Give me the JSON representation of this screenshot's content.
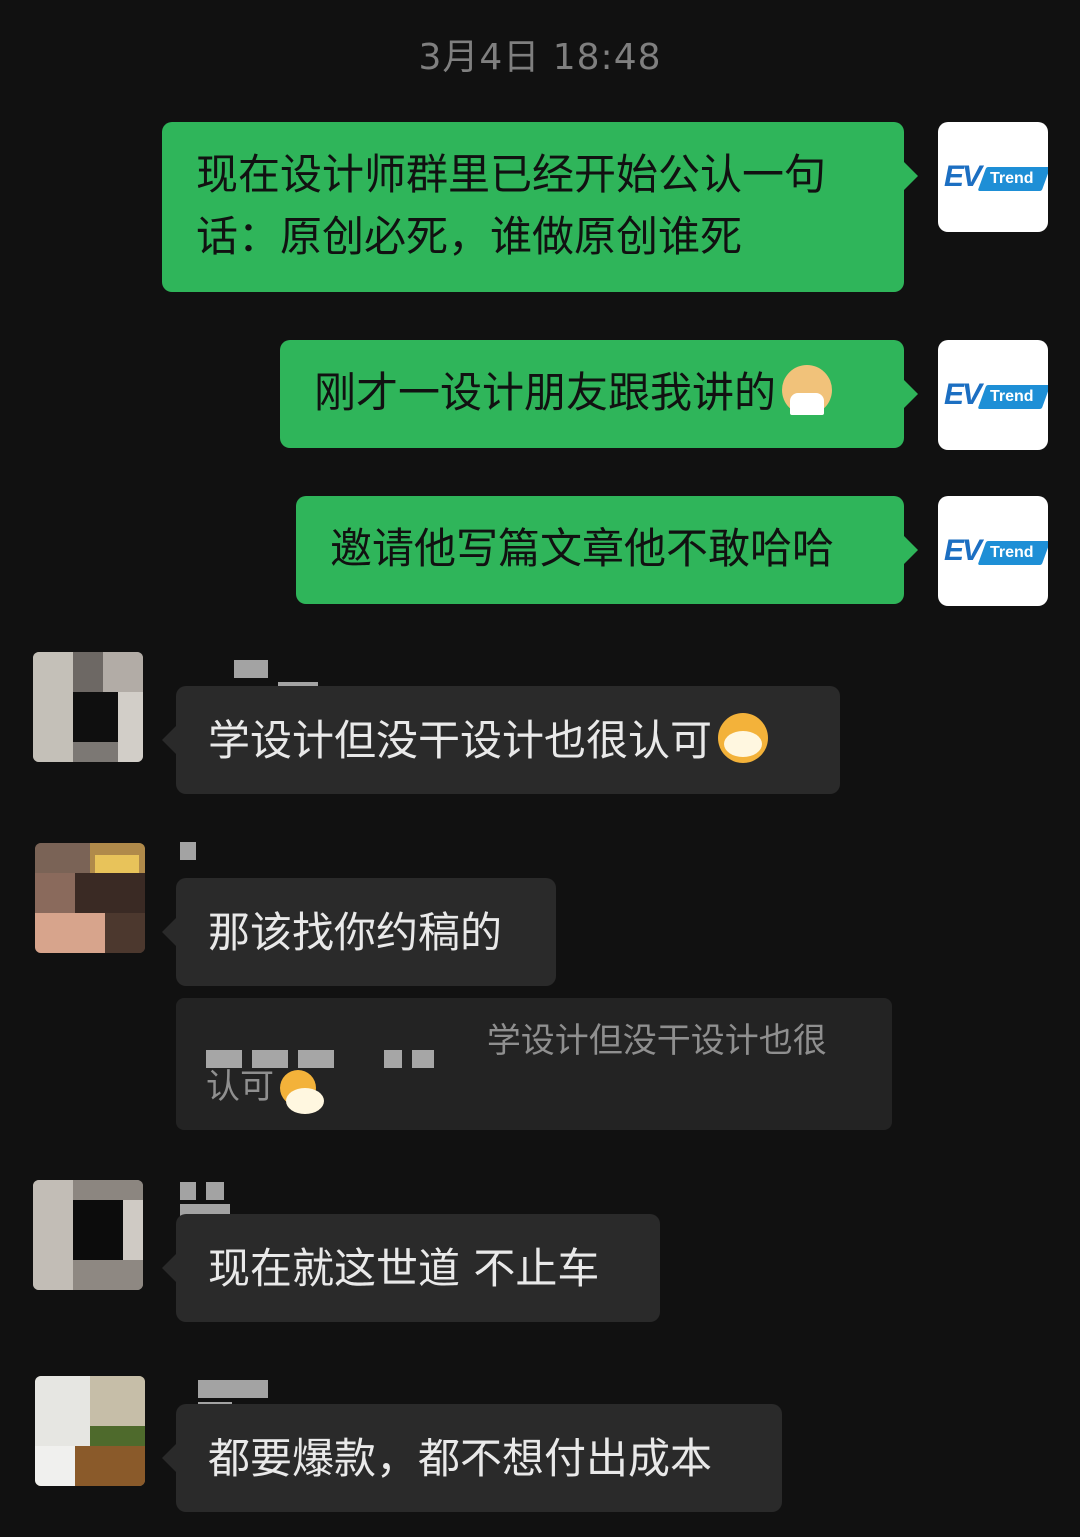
{
  "chat": {
    "timestamp": "3月4日 18:48",
    "outgoing": [
      {
        "line1": "现在设计师群里已经开始公认一句",
        "line2": "话：原创必死，谁做原创谁死"
      },
      {
        "text": "刚才一设计朋友跟我讲的",
        "emoji": "person-shrugging-icon"
      },
      {
        "text": "邀请他写篇文章他不敢哈哈"
      }
    ],
    "incoming": [
      {
        "text": "学设计但没干设计也很认可",
        "emoji": "cat-face-icon"
      },
      {
        "text": "那该找你约稿的",
        "quote_line1": "学设计但没干设计也很",
        "quote_line2": "认可"
      },
      {
        "text": "现在就这世道 不止车"
      },
      {
        "text": "都要爆款，都不想付出成本"
      }
    ],
    "avatar_logo": {
      "mark": "EV",
      "word": "Trend"
    }
  },
  "colors": {
    "background": "#111111",
    "outgoing_bubble": "#2fb55a",
    "incoming_bubble": "#2a2a2a",
    "quote_bubble": "#232323",
    "brand_blue": "#1e8fd6"
  }
}
